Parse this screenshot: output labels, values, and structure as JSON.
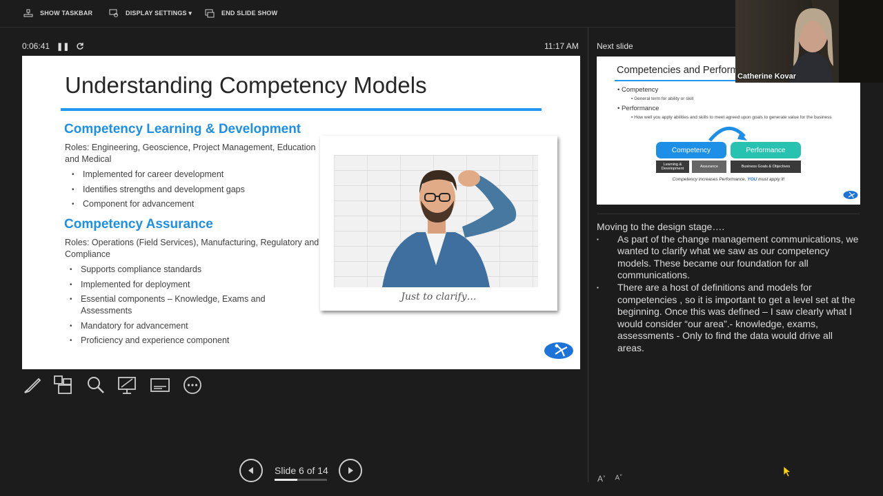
{
  "topbar": {
    "show_taskbar": "SHOW TASKBAR",
    "display_settings": "DISPLAY SETTINGS ▾",
    "end_slide_show": "END SLIDE SHOW"
  },
  "status": {
    "elapsed": "0:06:41",
    "clock": "11:17 AM",
    "next_slide_label": "Next slide"
  },
  "slide": {
    "title": "Understanding Competency Models",
    "section1": {
      "heading": "Competency Learning & Development",
      "roles": "Roles: Engineering, Geoscience, Project Management, Education and Medical",
      "bullets": [
        "Implemented for career development",
        "Identifies strengths and development gaps",
        "Component for advancement"
      ]
    },
    "section2": {
      "heading": "Competency Assurance",
      "roles": "Roles: Operations (Field Services), Manufacturing, Regulatory and Compliance",
      "bullets": [
        "Supports compliance standards",
        "Implemented for deployment",
        "Essential components – Knowledge, Exams and Assessments",
        "Mandatory for advancement",
        "Proficiency and experience component"
      ]
    },
    "image_caption": "Just to clarify…",
    "accent_color": "#1e8fe6"
  },
  "navigation": {
    "slide_counter": "Slide 6 of 14",
    "current": 6,
    "total": 14
  },
  "toolbar": {
    "icons": [
      "pen-icon",
      "slides-grid-icon",
      "zoom-icon",
      "pointer-screen-icon",
      "subtitles-icon",
      "more-options-icon"
    ]
  },
  "next_slide": {
    "title": "Competencies and Performance",
    "b1": "Competency",
    "b1_sub": "General term for ability or skill",
    "b2": "Performance",
    "b2_sub": "How well you apply abilities and skills to meet agreed upon goals to generate value for the business",
    "pill_left": "Competency",
    "pill_right": "Performance",
    "sub1": "Learning & Development",
    "sub2": "Assurance",
    "sub3": "Business Goals & Objectives",
    "caption_pre": "Competency increases Performance, ",
    "caption_you": "YOU",
    "caption_post": " must apply it!"
  },
  "webcam": {
    "name": "Catherine Kovar"
  },
  "notes": {
    "intro": "Moving to the design stage….",
    "items": [
      "As part of the change management communications, we wanted to clarify what we saw as our competency models.  These became our foundation for all communications.",
      "There are a host of definitions and models for competencies , so it is important to get a level set at the beginning.  Once this was defined – I saw clearly what I would consider “our area”.- knowledge, exams, assessments - Only to find the data would drive all areas."
    ]
  }
}
